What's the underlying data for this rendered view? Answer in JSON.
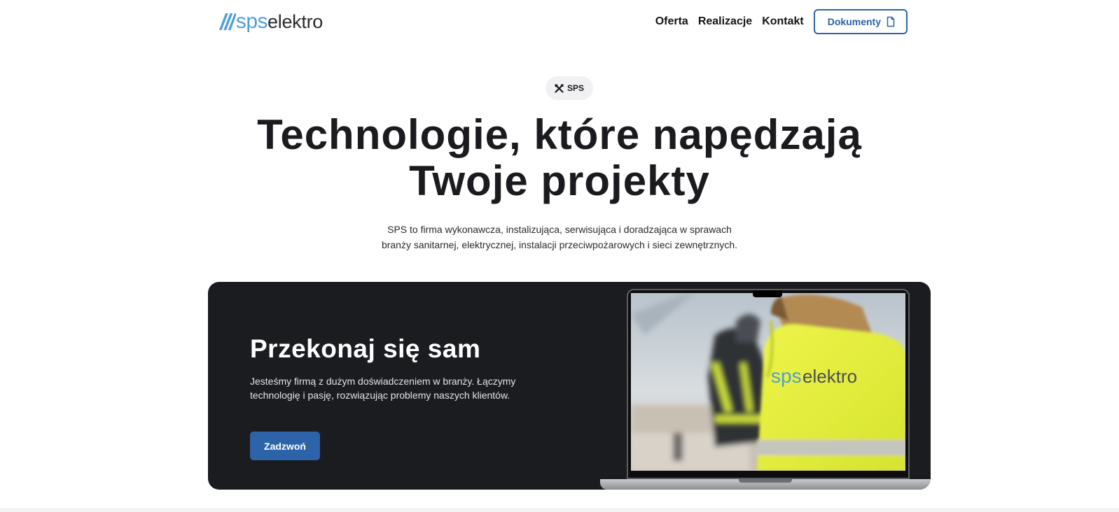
{
  "header": {
    "logo": {
      "sps": "sps",
      "elektro": "elektro",
      "mark_icon": "stripes-logo-icon",
      "brand_color": "#4f9fd8"
    },
    "nav": [
      {
        "label": "Oferta"
      },
      {
        "label": "Realizacje"
      },
      {
        "label": "Kontakt"
      }
    ],
    "docs_button": {
      "label": "Dokumenty",
      "icon": "document-icon"
    }
  },
  "hero": {
    "badge": {
      "label": "SPS",
      "icon": "tools-icon"
    },
    "title_line1": "Technologie, które napędzają",
    "title_line2": "Twoje projekty",
    "subtitle_line1": "SPS to firma wykonawcza, instalizująca, serwisująca i doradzająca w sprawach",
    "subtitle_line2": "branży sanitarnej, elektrycznej, instalacji przeciwpożarowych i sieci zewnętrznych."
  },
  "promo": {
    "title": "Przekonaj się sam",
    "text_line1": "Jesteśmy firmą z dużym doświadczeniem w branży. Łączymy",
    "text_line2": "technologię i pasję, rozwiązując problemy naszych klientów.",
    "call_button": "Zadzwoń",
    "laptop_image": {
      "vest_text_sps": "sps",
      "vest_text_elektro": "elektro"
    }
  },
  "colors": {
    "accent": "#2c63a9",
    "card_bg": "#1b1c20",
    "vest": "#e3f03a"
  }
}
